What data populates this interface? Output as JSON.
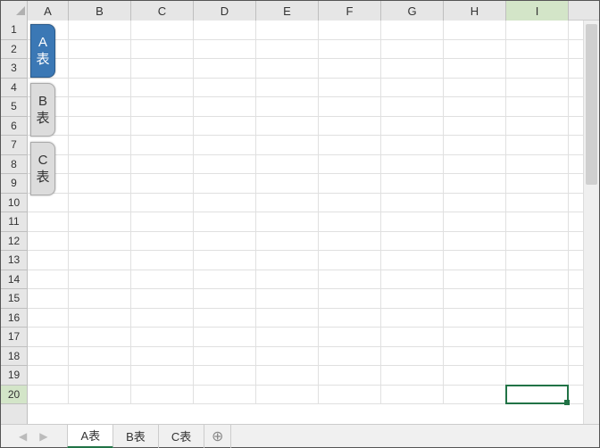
{
  "columns": [
    "A",
    "B",
    "C",
    "D",
    "E",
    "F",
    "G",
    "H",
    "I"
  ],
  "rows": [
    "1",
    "2",
    "3",
    "4",
    "5",
    "6",
    "7",
    "8",
    "9",
    "10",
    "11",
    "12",
    "13",
    "14",
    "15",
    "16",
    "17",
    "18",
    "19",
    "20"
  ],
  "selected_col_index": 8,
  "selected_row_index": 19,
  "selected_cell": "I20",
  "nav_shapes": [
    {
      "label_top": "A",
      "label_bottom": "表",
      "active": true
    },
    {
      "label_top": "B",
      "label_bottom": "表",
      "active": false
    },
    {
      "label_top": "C",
      "label_bottom": "表",
      "active": false
    }
  ],
  "sheet_tabs": [
    {
      "label": "A表",
      "active": true
    },
    {
      "label": "B表",
      "active": false
    },
    {
      "label": "C表",
      "active": false
    }
  ],
  "add_sheet_glyph": "⊕",
  "nav_prev_glyph": "◀",
  "nav_next_glyph": "▶"
}
